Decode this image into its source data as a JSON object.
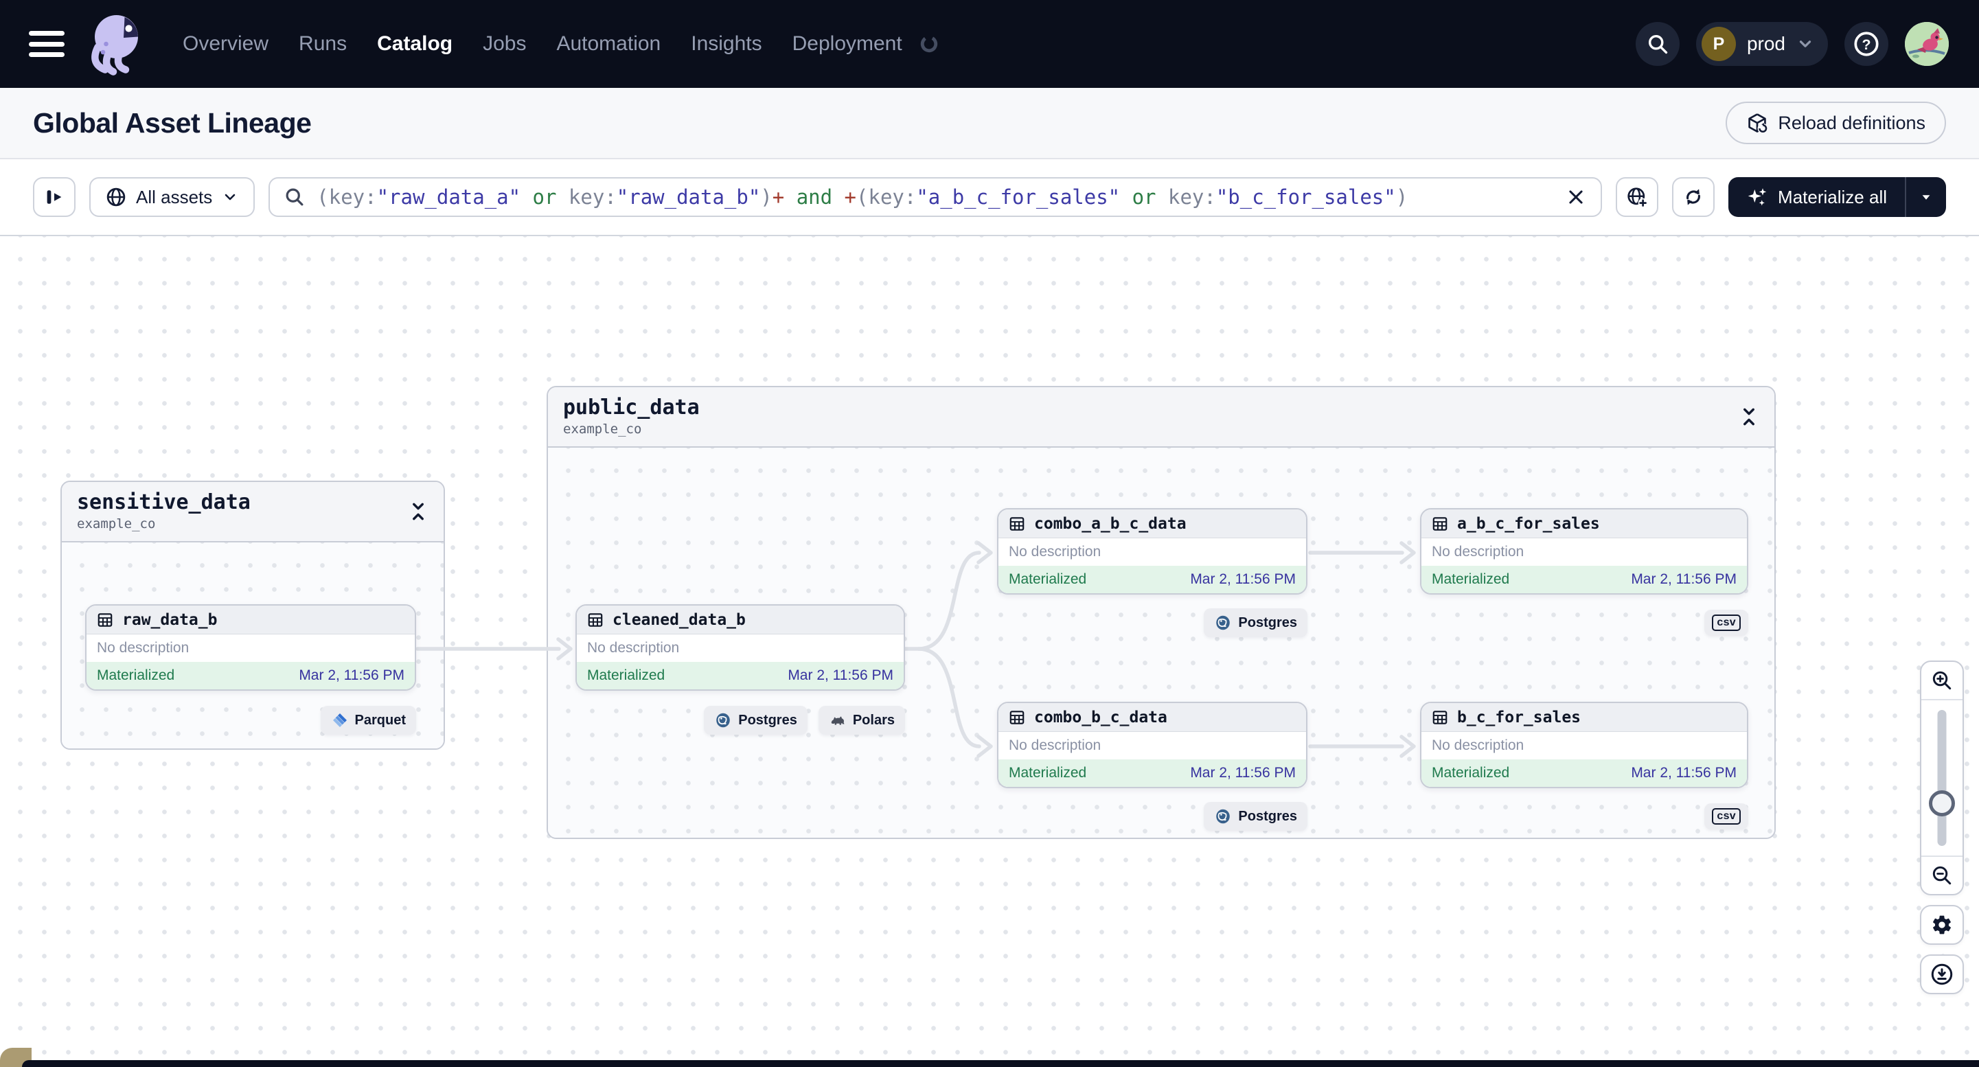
{
  "navbar": {
    "items": [
      {
        "label": "Overview",
        "active": false
      },
      {
        "label": "Runs",
        "active": false
      },
      {
        "label": "Catalog",
        "active": true
      },
      {
        "label": "Jobs",
        "active": false
      },
      {
        "label": "Automation",
        "active": false
      },
      {
        "label": "Insights",
        "active": false
      },
      {
        "label": "Deployment",
        "active": false
      }
    ],
    "environment": {
      "initial": "P",
      "name": "prod"
    }
  },
  "header": {
    "title": "Global Asset Lineage",
    "reload_button": "Reload definitions"
  },
  "filterbar": {
    "scope_label": "All assets",
    "materialize_button": "Materialize all",
    "query_segments": [
      {
        "text": "(",
        "type": "punct"
      },
      {
        "text": "key:",
        "type": "punct"
      },
      {
        "text": "\"raw_data_a\"",
        "type": "value"
      },
      {
        "text": " or ",
        "type": "op"
      },
      {
        "text": "key:",
        "type": "punct"
      },
      {
        "text": "\"raw_data_b\"",
        "type": "value"
      },
      {
        "text": ")",
        "type": "punct"
      },
      {
        "text": "+",
        "type": "plus"
      },
      {
        "text": " and ",
        "type": "op"
      },
      {
        "text": "+",
        "type": "plus"
      },
      {
        "text": "(",
        "type": "punct"
      },
      {
        "text": "key:",
        "type": "punct"
      },
      {
        "text": "\"a_b_c_for_sales\"",
        "type": "value"
      },
      {
        "text": " or ",
        "type": "op"
      },
      {
        "text": "key:",
        "type": "punct"
      },
      {
        "text": "\"b_c_for_sales\"",
        "type": "value"
      },
      {
        "text": ")",
        "type": "punct"
      }
    ]
  },
  "graph": {
    "groups": [
      {
        "name": "sensitive_data",
        "location": "example_co"
      },
      {
        "name": "public_data",
        "location": "example_co"
      }
    ],
    "nodes": [
      {
        "name": "raw_data_b",
        "description": "No description",
        "status": "Materialized",
        "timestamp": "Mar 2, 11:56 PM",
        "tags": [
          "Parquet"
        ]
      },
      {
        "name": "cleaned_data_b",
        "description": "No description",
        "status": "Materialized",
        "timestamp": "Mar 2, 11:56 PM",
        "tags": [
          "Postgres",
          "Polars"
        ]
      },
      {
        "name": "combo_a_b_c_data",
        "description": "No description",
        "status": "Materialized",
        "timestamp": "Mar 2, 11:56 PM",
        "tags": [
          "Postgres"
        ]
      },
      {
        "name": "a_b_c_for_sales",
        "description": "No description",
        "status": "Materialized",
        "timestamp": "Mar 2, 11:56 PM",
        "tags": [
          "csv"
        ]
      },
      {
        "name": "combo_b_c_data",
        "description": "No description",
        "status": "Materialized",
        "timestamp": "Mar 2, 11:56 PM",
        "tags": [
          "Postgres"
        ]
      },
      {
        "name": "b_c_for_sales",
        "description": "No description",
        "status": "Materialized",
        "timestamp": "Mar 2, 11:56 PM",
        "tags": [
          "csv"
        ]
      }
    ],
    "edges": [
      {
        "from": "raw_data_b",
        "to": "cleaned_data_b"
      },
      {
        "from": "cleaned_data_b",
        "to": "combo_a_b_c_data"
      },
      {
        "from": "cleaned_data_b",
        "to": "combo_b_c_data"
      },
      {
        "from": "combo_a_b_c_data",
        "to": "a_b_c_for_sales"
      },
      {
        "from": "combo_b_c_data",
        "to": "b_c_for_sales"
      }
    ]
  },
  "icons": {
    "nav": [
      "hamburger-menu",
      "dagster-octopus-logo",
      "search",
      "help",
      "user-avatar-bird"
    ],
    "filter": [
      "panel-expand",
      "globe",
      "magnifier",
      "clear-x",
      "globe-plus",
      "sync",
      "sparkles",
      "caret-down"
    ],
    "graph": [
      "table-grid",
      "collapse-vertical",
      "parquet-diamond",
      "postgres-elephant",
      "polars-bear",
      "csv-badge"
    ],
    "controls": [
      "zoom-in",
      "zoom-out",
      "zoom-slider",
      "settings-gear",
      "download-circle"
    ]
  },
  "colors": {
    "navbar_bg": "#0a0e1b",
    "accent_dark_button": "#10172a",
    "materialized_green": "#1f7a4d",
    "materialized_bg": "#e3f4e9",
    "timestamp_indigo": "#37329f",
    "query_value": "#3d3aa6",
    "query_operator": "#2d7d46",
    "query_plus": "#a33d2f",
    "edge_gray": "#dde0e6"
  }
}
